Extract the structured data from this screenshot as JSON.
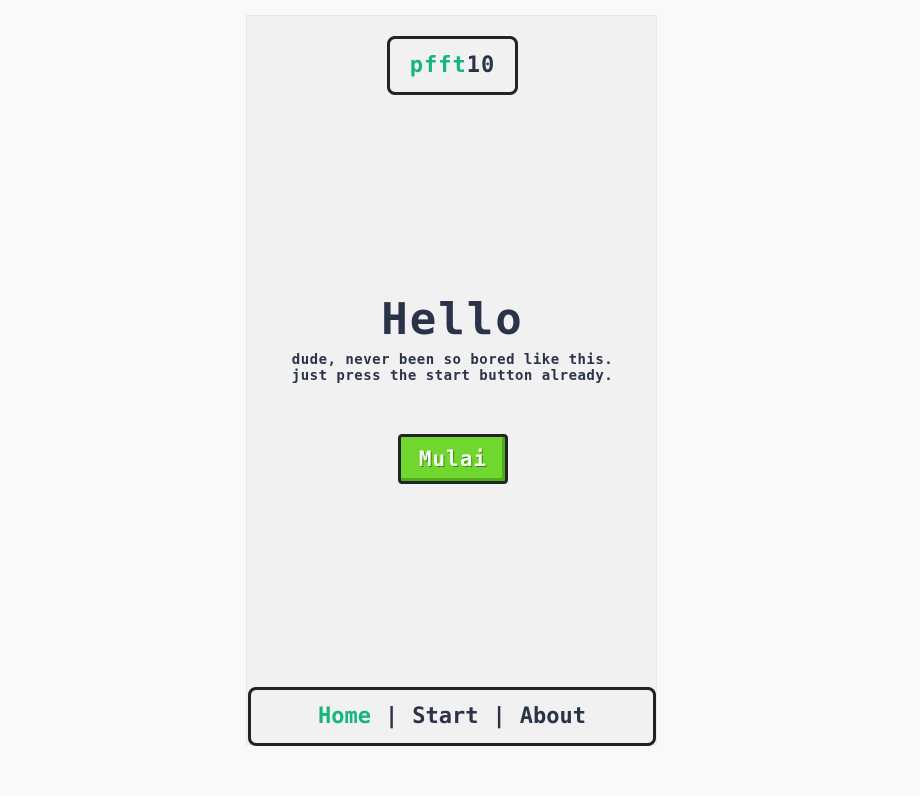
{
  "logo": {
    "accent_text": "pfft",
    "rest_text": "10"
  },
  "hero": {
    "title": "Hello",
    "description": "dude, never been so bored like this. just press the start button already."
  },
  "start_button": {
    "label": "Mulai"
  },
  "nav": {
    "items": [
      {
        "label": "Home",
        "active": true
      },
      {
        "label": "Start",
        "active": false
      },
      {
        "label": "About",
        "active": false
      }
    ],
    "separator": "|"
  },
  "colors": {
    "accent": "#16b67b",
    "text": "#2a3348",
    "button": "#6fd72e",
    "border": "#212328",
    "panel": "#f1f1f1"
  }
}
